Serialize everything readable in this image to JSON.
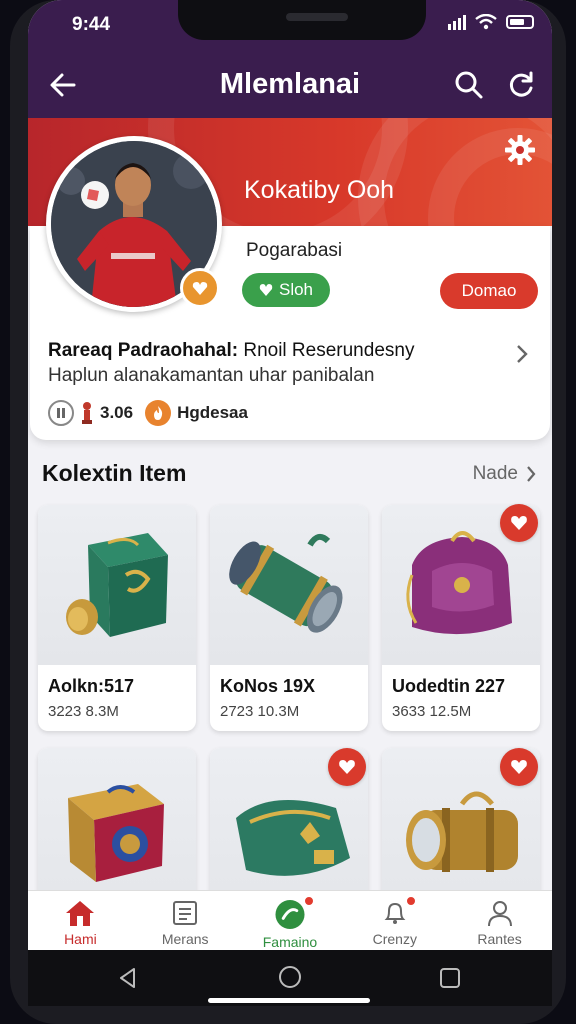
{
  "status": {
    "time": "9:44"
  },
  "appbar": {
    "title": "Mlemlanai"
  },
  "profile": {
    "name": "Kokatiby Ooh",
    "subtitle": "Pogarabasi",
    "follow_label": "Sloh",
    "donate_label": "Domao",
    "desc_bold": "Rareaq Padraohahal:",
    "desc_rest": " Rnoil Reserundesny",
    "desc_line2": "Haplun alanakamantan uhar panibalan",
    "stat_count": "3.06",
    "stat_label": "Hgdesaa"
  },
  "collection": {
    "title": "Kolextin Item",
    "more_label": "Nade",
    "items": [
      {
        "label": "Aolkn:517",
        "meta": "3223 8.3M"
      },
      {
        "label": "KoNos 19X",
        "meta": "2723 10.3M"
      },
      {
        "label": "Uodedtin 227",
        "meta": "3633 12.5M"
      },
      {
        "label": "",
        "meta": ""
      },
      {
        "label": "",
        "meta": ""
      },
      {
        "label": "",
        "meta": ""
      }
    ]
  },
  "tabs": [
    {
      "label": "Hami"
    },
    {
      "label": "Merans"
    },
    {
      "label": "Famaino"
    },
    {
      "label": "Crenzy"
    },
    {
      "label": "Rantes"
    }
  ],
  "colors": {
    "appbar": "#3a1d4e",
    "accent_red": "#d93a2c",
    "accent_green": "#3aa04b"
  }
}
